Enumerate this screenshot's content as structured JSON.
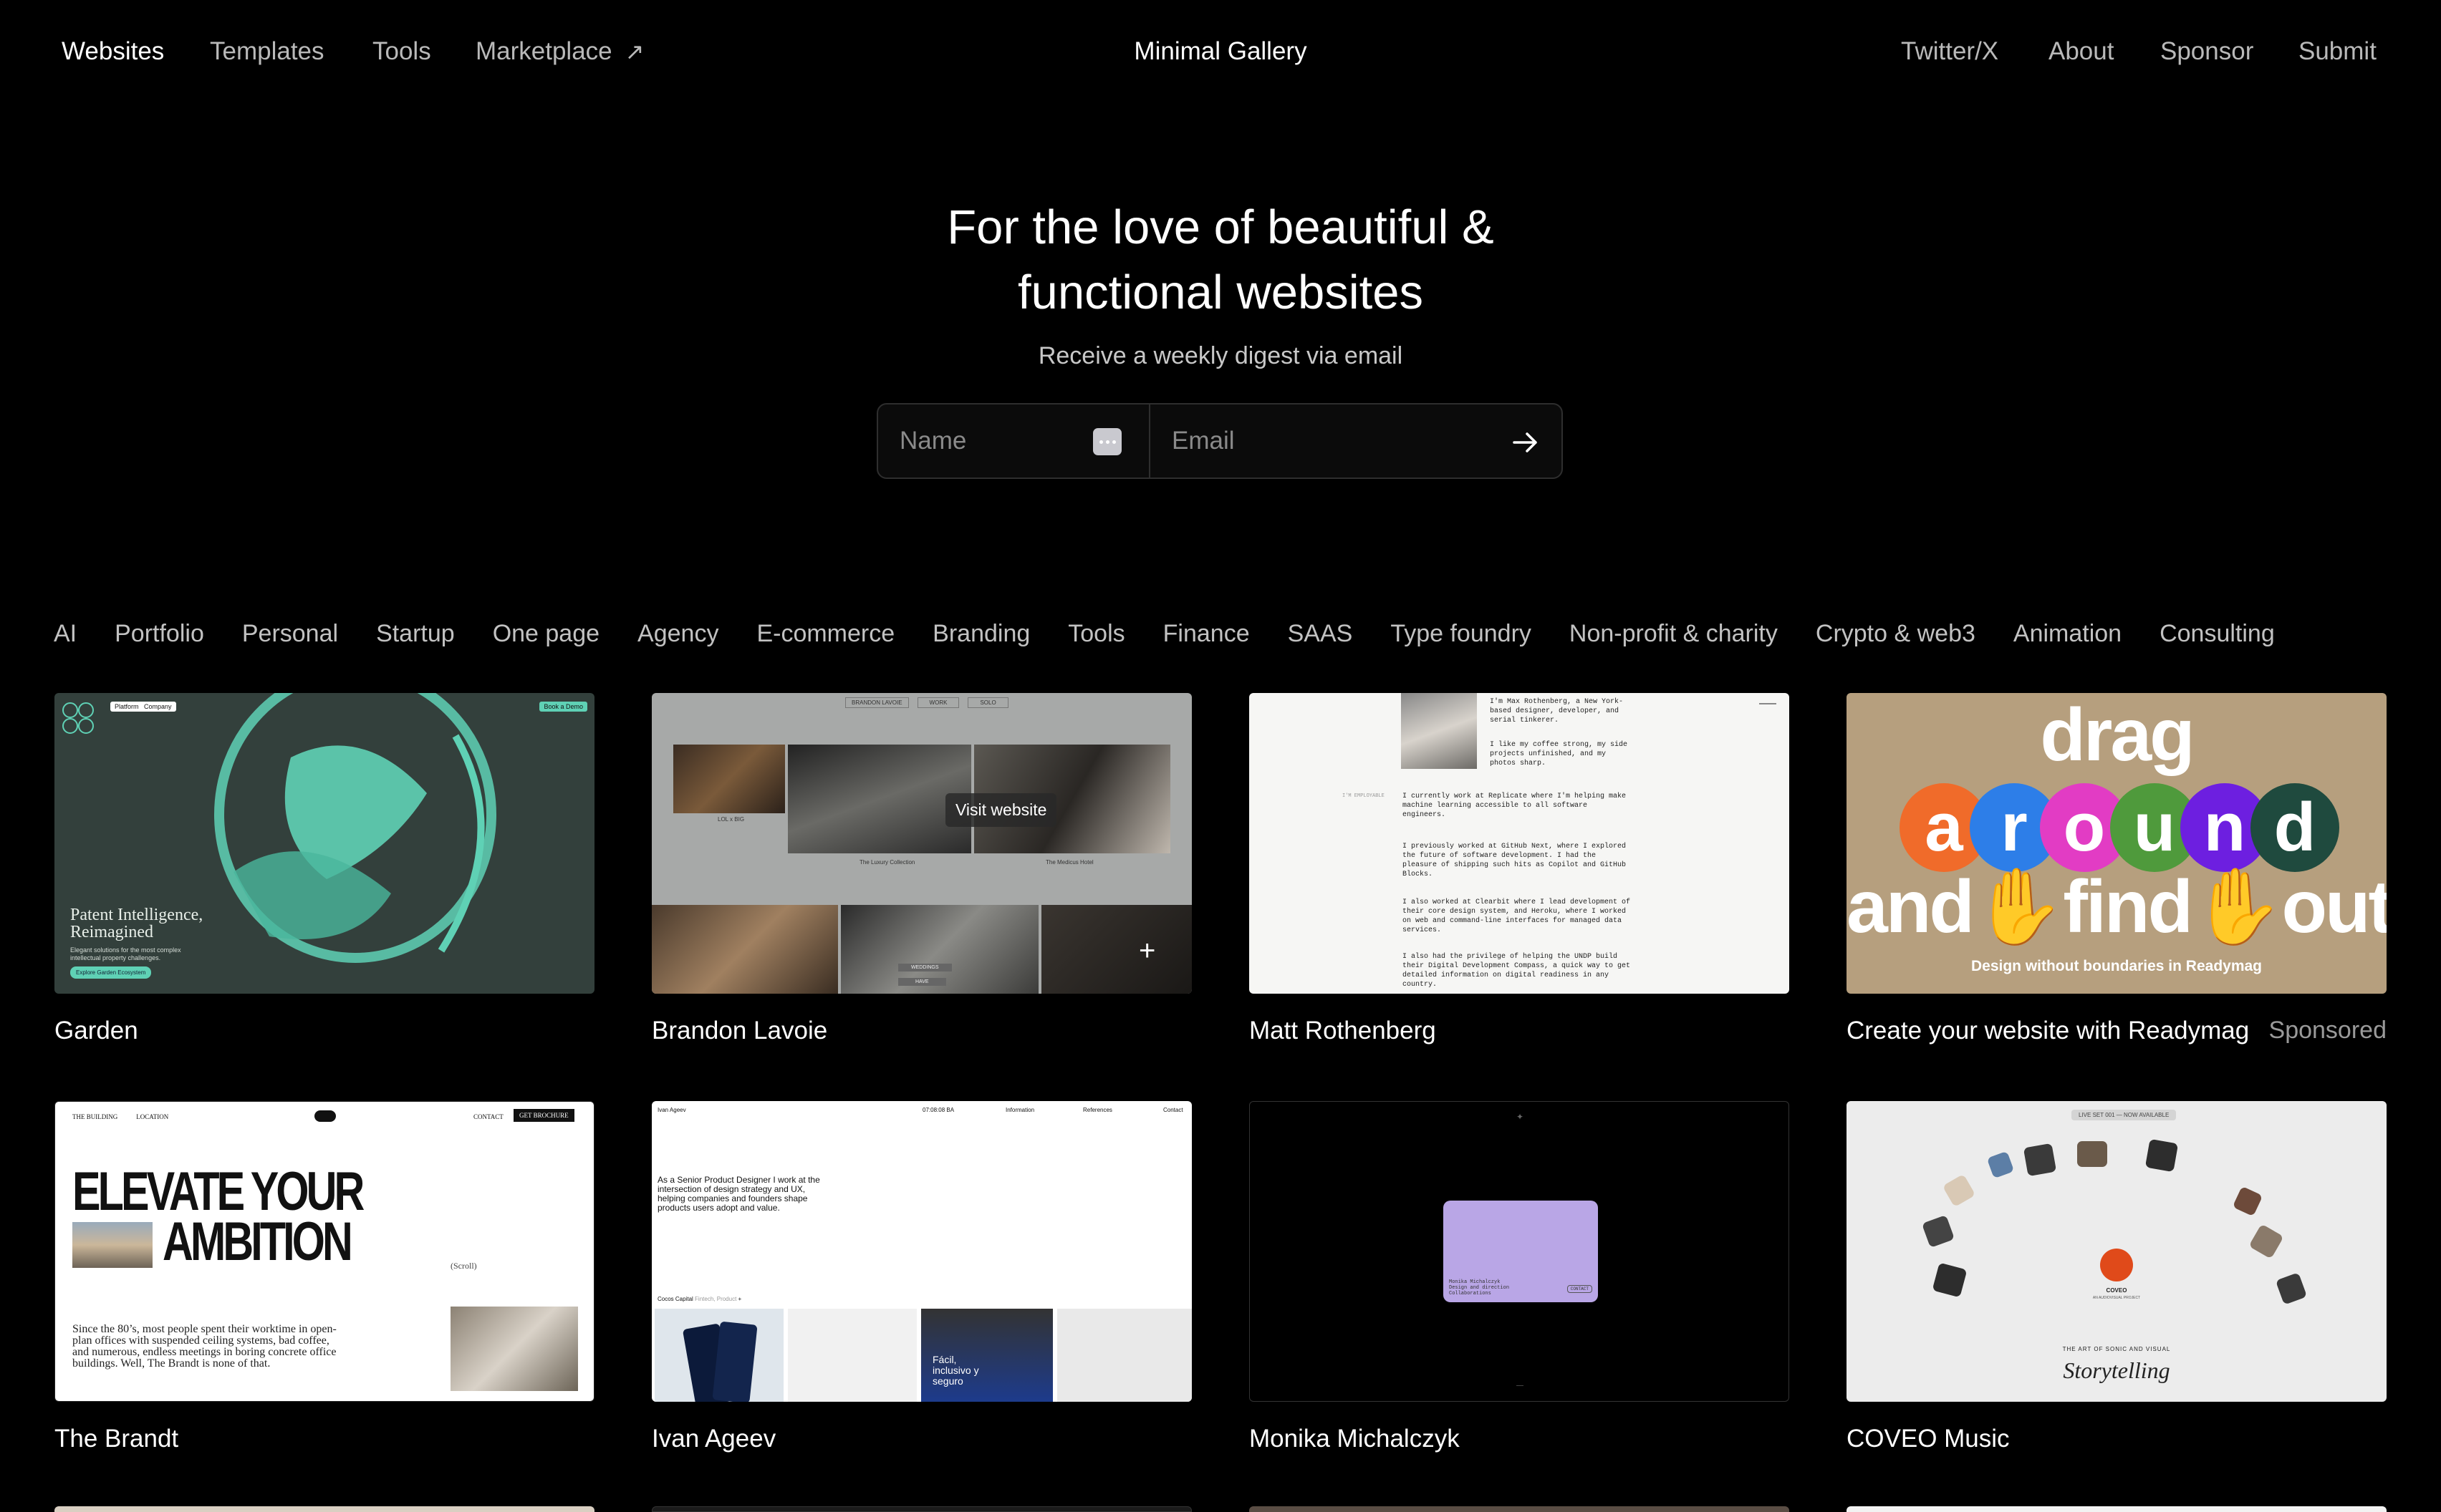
{
  "nav": {
    "left": [
      "Websites",
      "Templates",
      "Tools",
      "Marketplace"
    ],
    "brand": "Minimal Gallery",
    "right": [
      "Twitter/X",
      "About",
      "Sponsor",
      "Submit"
    ]
  },
  "hero": {
    "title_line1": "For the love of beautiful &",
    "title_line2": "functional websites",
    "subtitle": "Receive a weekly digest via email",
    "name_placeholder": "Name",
    "email_placeholder": "Email"
  },
  "categories": [
    "AI",
    "Portfolio",
    "Personal",
    "Startup",
    "One page",
    "Agency",
    "E-commerce",
    "Branding",
    "Tools",
    "Finance",
    "SAAS",
    "Type foundry",
    "Non-profit & charity",
    "Crypto & web3",
    "Animation",
    "Consulting"
  ],
  "cards": [
    {
      "title": "Garden"
    },
    {
      "title": "Brandon Lavoie",
      "hover": "Visit website"
    },
    {
      "title": "Matt Rothenberg"
    },
    {
      "title": "Create your website with Readymag",
      "badge": "Sponsored"
    },
    {
      "title": "The Brandt"
    },
    {
      "title": "Ivan Ageev"
    },
    {
      "title": "Monika Michalczyk"
    },
    {
      "title": "COVEO Music"
    }
  ],
  "thumbs": {
    "garden": {
      "tag1": "Platform",
      "tag2": "Company",
      "cta": "Book a Demo",
      "headline1": "Patent Intelligence,",
      "headline2": "Reimagined",
      "body": "Elegant solutions for the most complex intellectual property challenges.",
      "button": "Explore Garden Ecosystem"
    },
    "brandon": {
      "menu1": "BRANDON LAVOIE",
      "menu2": "WORK",
      "menu3": "SOLO",
      "cap1": "LOL x BIG",
      "cap2": "The Luxury Collection",
      "cap3": "The Medicus Hotel",
      "pill1": "WEDDINGS",
      "pill2": "HAVE"
    },
    "matt": {
      "p1": "I'm Max Rothenberg, a New York-based designer, developer, and serial tinkerer.",
      "p2": "I like my coffee strong, my side projects unfinished, and my photos sharp.",
      "side": "I'M EMPLOYABLE",
      "p3": "I currently work at Replicate where I'm helping make machine learning accessible to all software engineers.",
      "p4": "I previously worked at GitHub Next, where I explored the future of software development. I had the pleasure of shipping such hits as Copilot and GitHub Blocks.",
      "p5": "I also worked at Clearbit where I lead development of their core design system, and Heroku, where I worked on web and command-line interfaces for managed data services.",
      "p6": "I also had the privilege of helping the UNDP build their Digital Development Compass, a quick way to get detailed information on digital readiness in any country."
    },
    "readymag": {
      "w1": "drag",
      "letters": [
        "a",
        "r",
        "o",
        "u",
        "n",
        "d"
      ],
      "w3a": "and",
      "w3b": "find",
      "w3c": "out",
      "tagline": "Design without boundaries in Readymag"
    },
    "brandt": {
      "nav1": "THE BUILDING",
      "nav2": "LOCATION",
      "nav3": "CONTACT",
      "nav4": "GET BROCHURE",
      "h1": "ELEVATE YOUR",
      "h2": "AMBITION",
      "scroll": "(Scroll)",
      "body": "Since the 80’s, most people spent their worktime in open-plan offices with suspended ceiling systems, bad coffee, and numerous, endless meetings in boring concrete office buildings. Well, The Brandt is none of that."
    },
    "ivan": {
      "name": "Ivan Ageev",
      "time": "07:08:08 BA",
      "n1": "Information",
      "n2": "References",
      "n3": "Contact",
      "intro": "As a Senior Product Designer I work at the intersection of design strategy and UX, helping companies and founders shape products users adopt and value.",
      "proj": "Cocos Capital",
      "projtags": "Fintech, Product",
      "sign": "Fácil, inclusivo y seguro"
    },
    "monika": {
      "card1": "Monika Michalczyk",
      "card2": "Design and direction",
      "card3": "Collaborations",
      "badge": "CONTACT"
    },
    "coveo": {
      "pill": "LIVE SET 001 — NOW AVAILABLE",
      "brand": "COVEO",
      "brandsub": "AN AUDIOVISUAL PROJECT",
      "art": "THE ART OF SONIC AND VISUAL",
      "script": "Storytelling"
    }
  },
  "colors": {
    "bg": "#000000",
    "garden_bg": "#33403c",
    "garden_accent": "#5fd1b5",
    "readymag_bg": "#b69f7e"
  }
}
